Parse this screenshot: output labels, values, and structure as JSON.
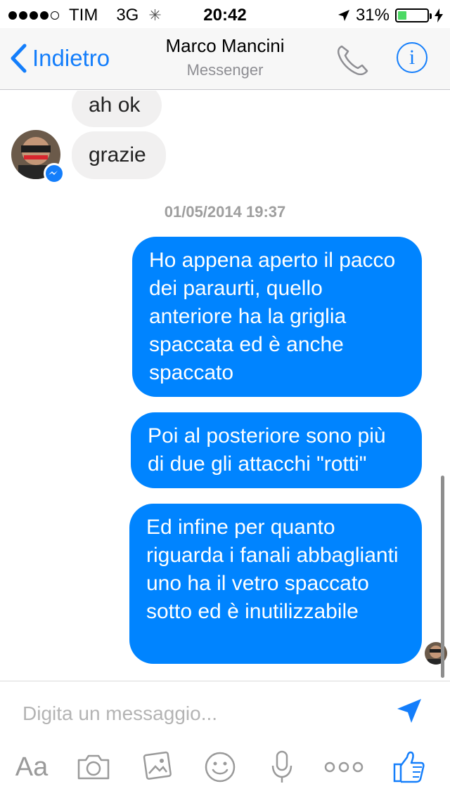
{
  "status_bar": {
    "carrier": "TIM",
    "network": "3G",
    "time": "20:42",
    "battery_percent": "31%",
    "battery_level": 0.31
  },
  "nav": {
    "back_label": "Indietro",
    "contact_name": "Marco Mancini",
    "subtitle": "Messenger"
  },
  "conversation": {
    "received": [
      "ah ok",
      "grazie"
    ],
    "timestamp": "01/05/2014 19:37",
    "sent": [
      "Ho appena aperto il pacco dei paraurti, quello anteriore ha la griglia spaccata ed è anche spaccato",
      "Poi al posteriore sono più di due gli attacchi \"rotti\"",
      "Ed infine per quanto riguarda i fanali abbaglianti uno ha il vetro spaccato sotto ed è inutilizzabile"
    ]
  },
  "composer": {
    "placeholder": "Digita un messaggio...",
    "text_tool_label": "Aa"
  },
  "icons": [
    "back-chevron-icon",
    "phone-icon",
    "info-icon",
    "messenger-badge-icon",
    "send-icon",
    "camera-icon",
    "photos-icon",
    "sticker-icon",
    "microphone-icon",
    "more-icon",
    "like-icon"
  ],
  "colors": {
    "accent": "#147efb",
    "sent_bubble": "#0084ff",
    "received_bubble": "#f1f0f0",
    "battery": "#4cd964"
  }
}
